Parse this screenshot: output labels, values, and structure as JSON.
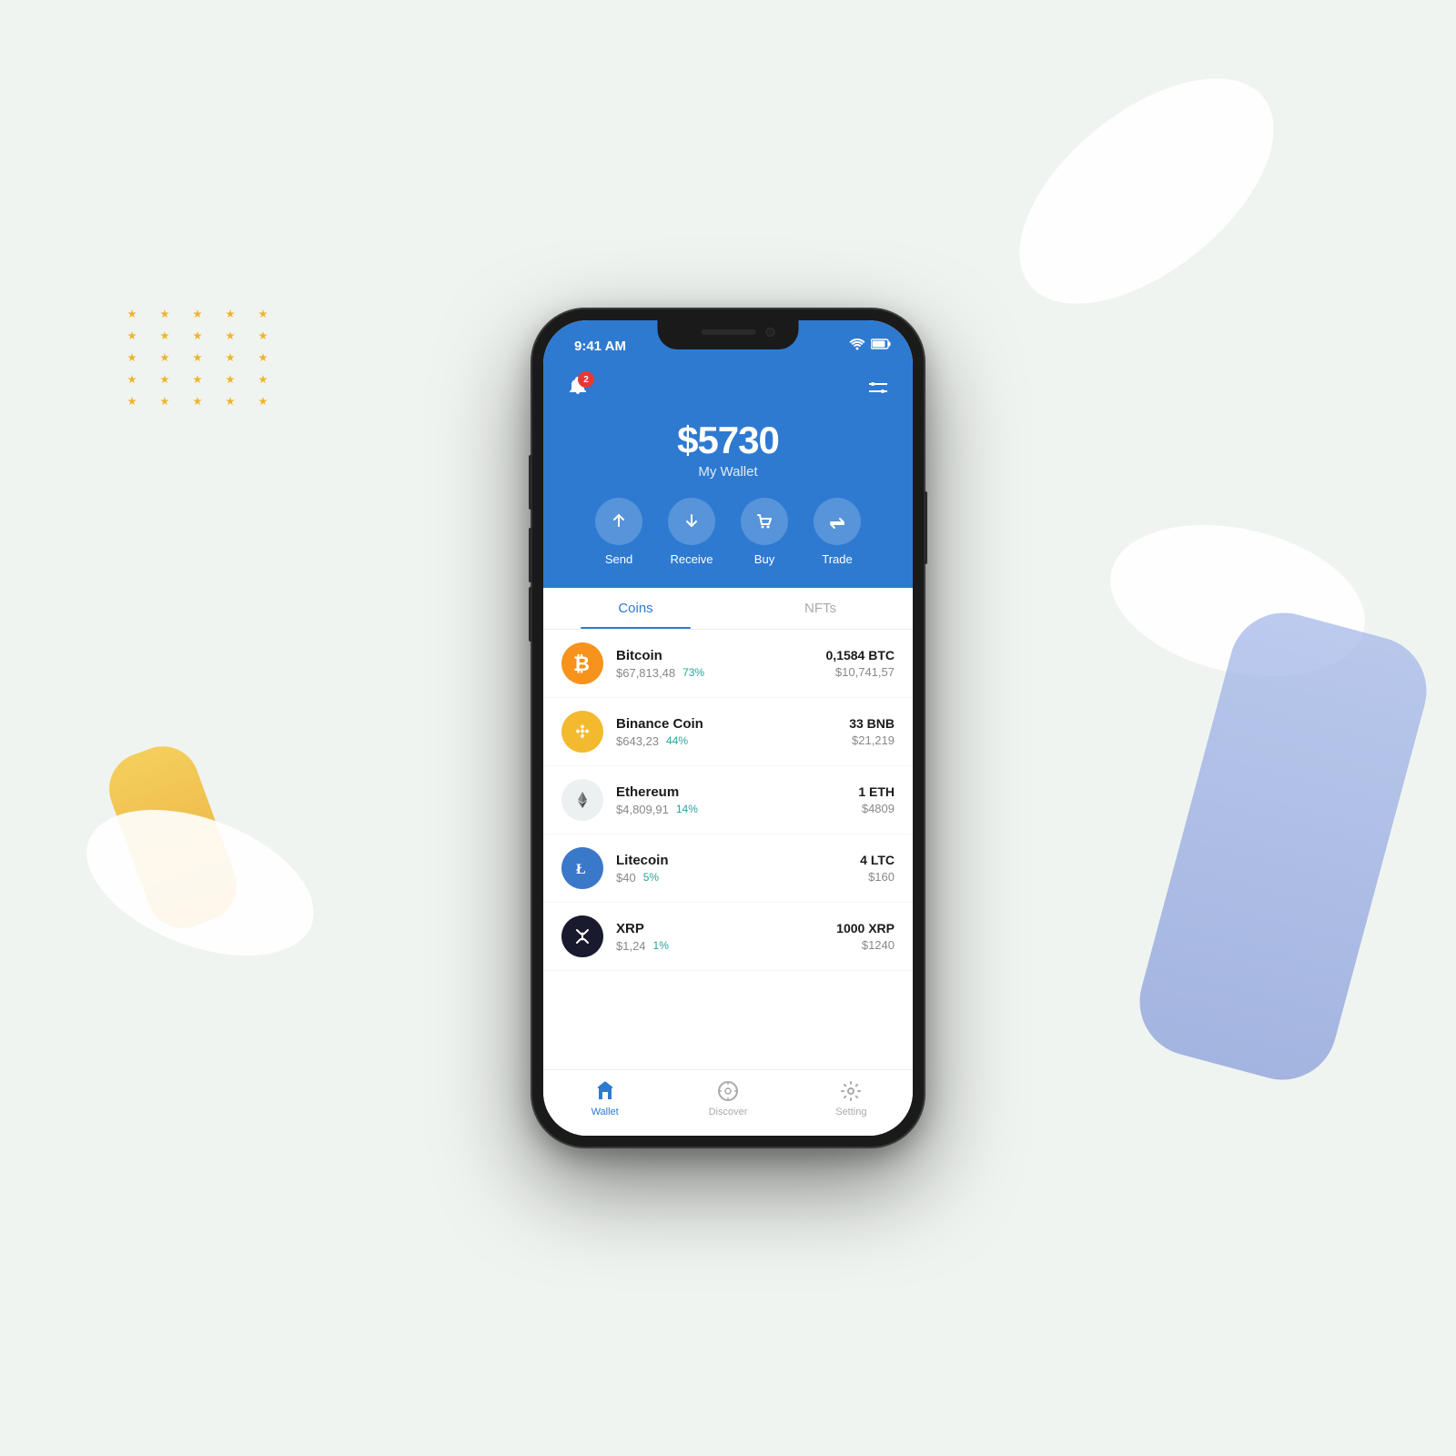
{
  "background": {
    "color": "#edf2ed"
  },
  "statusBar": {
    "time": "9:41 AM"
  },
  "header": {
    "notificationCount": "2",
    "balanceAmount": "$5730",
    "balanceLabel": "My Wallet",
    "actions": [
      {
        "id": "send",
        "label": "Send"
      },
      {
        "id": "receive",
        "label": "Receive"
      },
      {
        "id": "buy",
        "label": "Buy"
      },
      {
        "id": "trade",
        "label": "Trade"
      }
    ]
  },
  "tabs": [
    {
      "id": "coins",
      "label": "Coins",
      "active": true
    },
    {
      "id": "nfts",
      "label": "NFTs",
      "active": false
    }
  ],
  "coins": [
    {
      "id": "btc",
      "name": "Bitcoin",
      "price": "$67,813,48",
      "change": "73%",
      "amount": "0,1584 BTC",
      "value": "$10,741,57",
      "iconClass": "btc",
      "iconText": "₿"
    },
    {
      "id": "bnb",
      "name": "Binance Coin",
      "price": "$643,23",
      "change": "44%",
      "amount": "33 BNB",
      "value": "$21,219",
      "iconClass": "bnb",
      "iconText": "◈"
    },
    {
      "id": "eth",
      "name": "Ethereum",
      "price": "$4,809,91",
      "change": "14%",
      "amount": "1 ETH",
      "value": "$4809",
      "iconClass": "eth",
      "iconText": "⟠"
    },
    {
      "id": "ltc",
      "name": "Litecoin",
      "price": "$40",
      "change": "5%",
      "amount": "4 LTC",
      "value": "$160",
      "iconClass": "ltc",
      "iconText": "Ł"
    },
    {
      "id": "xrp",
      "name": "XRP",
      "price": "$1,24",
      "change": "1%",
      "amount": "1000 XRP",
      "value": "$1240",
      "iconClass": "xrp",
      "iconText": "✕"
    }
  ],
  "bottomNav": [
    {
      "id": "wallet",
      "label": "Wallet",
      "active": true
    },
    {
      "id": "discover",
      "label": "Discover",
      "active": false
    },
    {
      "id": "setting",
      "label": "Setting",
      "active": false
    }
  ]
}
